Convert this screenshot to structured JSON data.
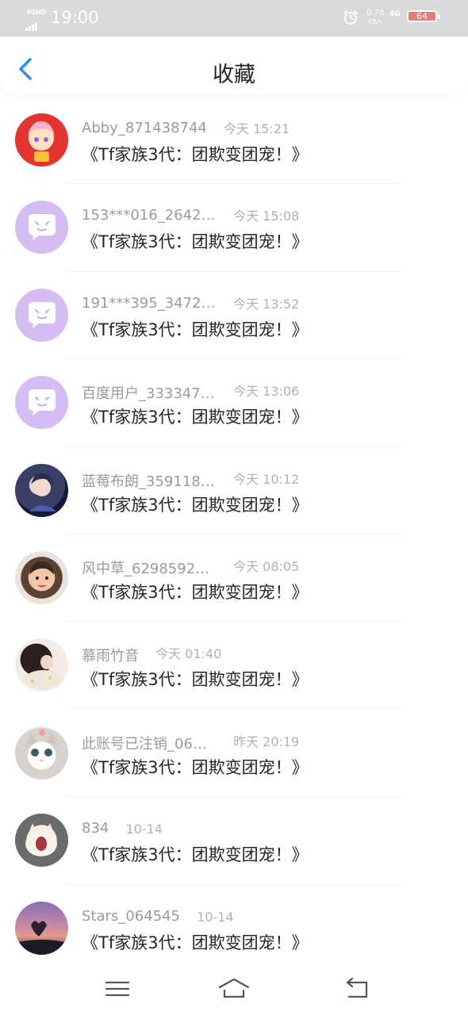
{
  "status_bar": {
    "network": "4GHD",
    "time": "19:00",
    "speed_value": "0.70",
    "speed_unit": "KB/s",
    "network_4g": "4G",
    "battery": "64",
    "icons": [
      "signal-icon",
      "alarm-icon",
      "battery-icon"
    ],
    "battery_color": "#e87a7e"
  },
  "header": {
    "title": "收藏",
    "back_icon": "chevron-left-icon",
    "accent": "#2a8ff0"
  },
  "favorites": [
    {
      "name": "Abby_871438744",
      "time": "今天 15:21",
      "title": "《Tf家族3代：团欺变团宠！》",
      "avatar": "anime-red"
    },
    {
      "name": "153***016_2642…",
      "time": "今天 15:08",
      "title": "《Tf家族3代：团欺变团宠！》",
      "avatar": "default-purple"
    },
    {
      "name": "191***395_3472…",
      "time": "今天 13:52",
      "title": "《Tf家族3代：团欺变团宠！》",
      "avatar": "default-purple"
    },
    {
      "name": "百度用户_333347…",
      "time": "今天 13:06",
      "title": "《Tf家族3代：团欺变团宠！》",
      "avatar": "default-purple"
    },
    {
      "name": "蓝莓布朗_359118…",
      "time": "今天 10:12",
      "title": "《Tf家族3代：团欺变团宠！》",
      "avatar": "anime-blue"
    },
    {
      "name": "风中草_6298592…",
      "time": "今天 08:05",
      "title": "《Tf家族3代：团欺变团宠！》",
      "avatar": "baby"
    },
    {
      "name": "慕雨竹音",
      "time": "今天 01:40",
      "title": "《Tf家族3代：团欺变团宠！》",
      "avatar": "girl"
    },
    {
      "name": "此账号已注销_06…",
      "time": "昨天 20:19",
      "title": "《Tf家族3代：团欺变团宠！》",
      "avatar": "cat"
    },
    {
      "name": "834",
      "time": "10-14",
      "title": "《Tf家族3代：团欺变团宠！》",
      "avatar": "yawn"
    },
    {
      "name": "Stars_064545",
      "time": "10-14",
      "title": "《Tf家族3代：团欺变团宠！》",
      "avatar": "sunset"
    }
  ],
  "nav_bar": {
    "icons": [
      "menu-icon",
      "home-icon",
      "back-icon"
    ]
  }
}
